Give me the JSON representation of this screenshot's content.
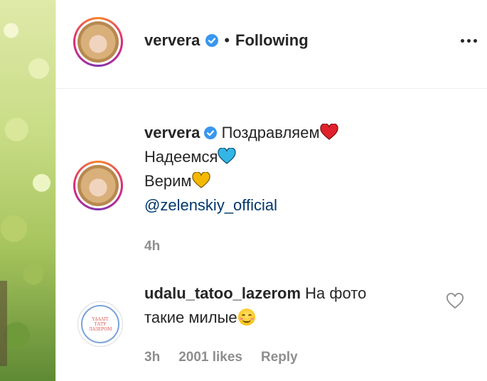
{
  "header": {
    "username": "ververa",
    "separator": "•",
    "follow_status": "Following"
  },
  "caption": {
    "username": "ververa",
    "line1": "Поздравляем",
    "line2": "Надеемся",
    "line3": "Верим",
    "mention": "@zelenskiy_official",
    "timestamp": "4h"
  },
  "comment": {
    "username": "udalu_tatoo_lazerom",
    "text_line1": "На фото",
    "text_line2": "такие милые",
    "timestamp": "3h",
    "likes": "2001 likes",
    "reply_label": "Reply"
  },
  "colors": {
    "verified": "#3897f0",
    "heart_red": "#e0212b",
    "heart_blue": "#33b5e5",
    "heart_yellow": "#f5b800",
    "mention": "#00376b",
    "meta_gray": "#8e8e8e"
  }
}
